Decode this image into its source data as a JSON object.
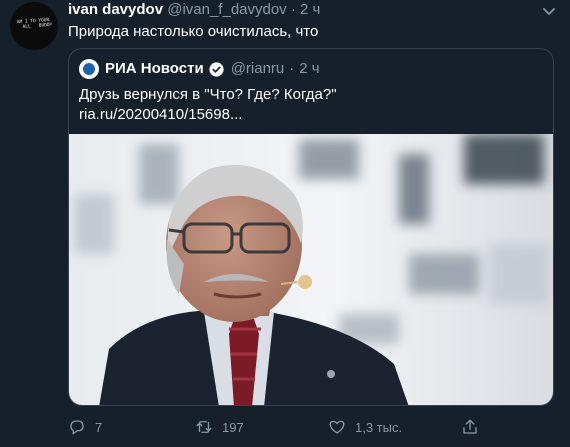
{
  "tweet": {
    "author_name": "ivan davydov",
    "author_handle": "@ivan_f_davydov",
    "separator": "·",
    "time": "2 ч",
    "text": "Природа настолько очистилась, что",
    "avatar_text": "AM I TO YOUR\n  ALL   BUDDY"
  },
  "quoted": {
    "author_name": "РИА Новости",
    "author_handle": "@rianru",
    "separator": "·",
    "time": "2 ч",
    "text": "Друзь вернулся в \"Что? Где? Когда?\"",
    "link": "ria.ru/20200410/15698..."
  },
  "actions": {
    "reply_count": "7",
    "retweet_count": "197",
    "like_count": "1,3 тыс."
  },
  "colors": {
    "background": "#15202b",
    "border": "#38444d",
    "muted": "#8899a6",
    "text": "#ffffff"
  }
}
